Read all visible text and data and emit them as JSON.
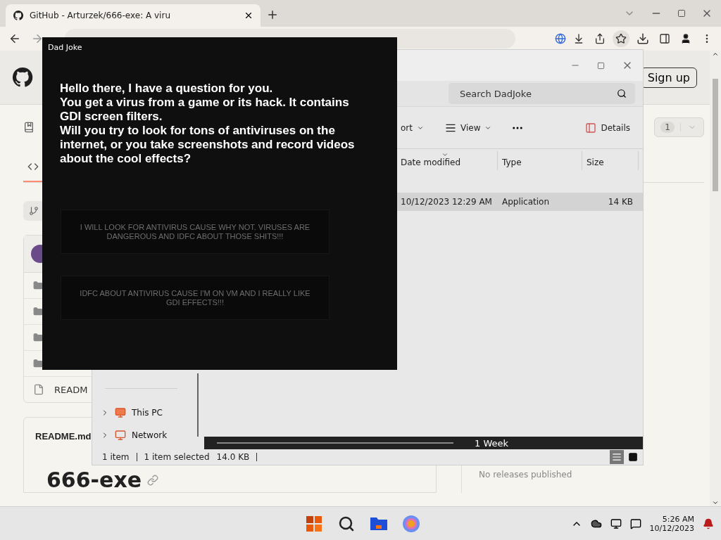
{
  "browser": {
    "tab": {
      "title": "GitHub - Arturzek/666-exe: A viru"
    },
    "page": {
      "sign_up": "Sign up",
      "counter": "1",
      "file_row": "READM",
      "readme_tab": "README.md",
      "heading": "666-exe",
      "releases_note": "No releases published"
    }
  },
  "explorer": {
    "search": {
      "placeholder": "Search DadJoke"
    },
    "toolbar": [
      {
        "kind": "sort",
        "label": "ort"
      },
      {
        "kind": "view",
        "label": "View"
      }
    ],
    "details": "Details",
    "columns": [
      {
        "label": "Date modified",
        "sorted": true
      },
      {
        "label": "Type",
        "sorted": false
      },
      {
        "label": "Size",
        "sorted": false
      }
    ],
    "rows": [
      {
        "date": "10/12/2023 12:29 AM",
        "type": "Application",
        "size": "14 KB",
        "selected": true
      }
    ],
    "nav": [
      {
        "label": "This PC",
        "expanded": false
      },
      {
        "label": "Network",
        "expanded": false
      }
    ],
    "overlay_bar": "1 Week",
    "status": {
      "count": "1 item",
      "selection": "1 item selected",
      "size": "14.0 KB"
    },
    "views": [
      {
        "kind": "details",
        "selected": true
      },
      {
        "kind": "tiles",
        "selected": false
      }
    ]
  },
  "dialog": {
    "title": "Dad Joke",
    "paragraphs": [
      "Hello there, I have a question for you.",
      "You get a virus from a game or its hack. It contains GDI screen filters.",
      "Will you try to look for tons of antiviruses on the internet, or you take screenshots and record videos about the cool effects?"
    ],
    "buttons": [
      "I WILL LOOK FOR ANTIVIRUS CAUSE WHY NOT. VIRUSES ARE DANGEROUS AND IDFC ABOUT THOSE SHITS!!!",
      "IDFC ABOUT ANTIVIRUS CAUSE I'M ON VM AND I REALLY LIKE GDI EFFECTS!!!"
    ]
  },
  "taskbar": {
    "time": "5:26 AM",
    "date": "10/12/2023"
  }
}
